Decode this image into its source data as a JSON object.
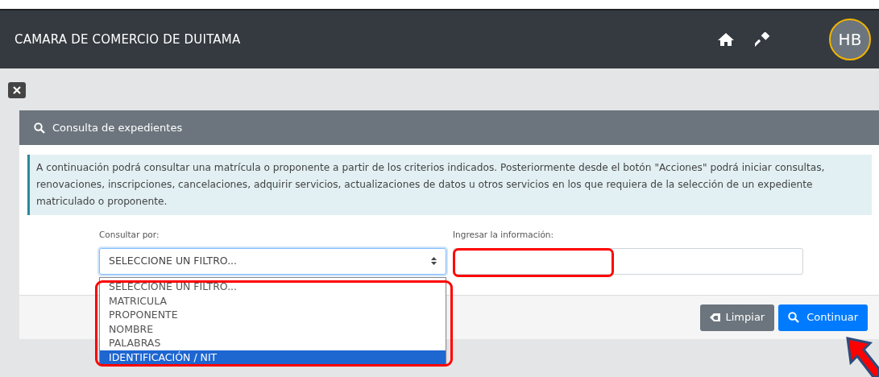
{
  "header": {
    "title": "CAMARA DE COMERCIO DE DUITAMA",
    "avatar": "HB"
  },
  "card": {
    "title": "Consulta de expedientes",
    "info": "A continuación podrá consultar una matrícula o proponente a partir de los criterios indicados. Posteriormente desde el botón \"Acciones\" podrá iniciar consultas, renovaciones, inscripciones, cancelaciones, adquirir servicios, actualizaciones de datos u otros servicios en los que requiera de la selección de un expediente matriculado o proponente.",
    "filter": {
      "label": "Consultar por:",
      "value": "SELECCIONE UN FILTRO...",
      "expanded": true,
      "options": [
        {
          "label": "SELECCIONE UN FILTRO...",
          "highlighted": false
        },
        {
          "label": "MATRICULA",
          "highlighted": false
        },
        {
          "label": "PROPONENTE",
          "highlighted": false
        },
        {
          "label": "NOMBRE",
          "highlighted": false
        },
        {
          "label": "PALABRAS",
          "highlighted": false
        },
        {
          "label": "IDENTIFICACIÓN / NIT",
          "highlighted": true
        }
      ]
    },
    "input": {
      "label": "Ingresar la información:"
    },
    "buttons": [
      {
        "kind": "clear",
        "label": "Limpiar"
      },
      {
        "kind": "search",
        "label": "Continuar"
      }
    ]
  }
}
